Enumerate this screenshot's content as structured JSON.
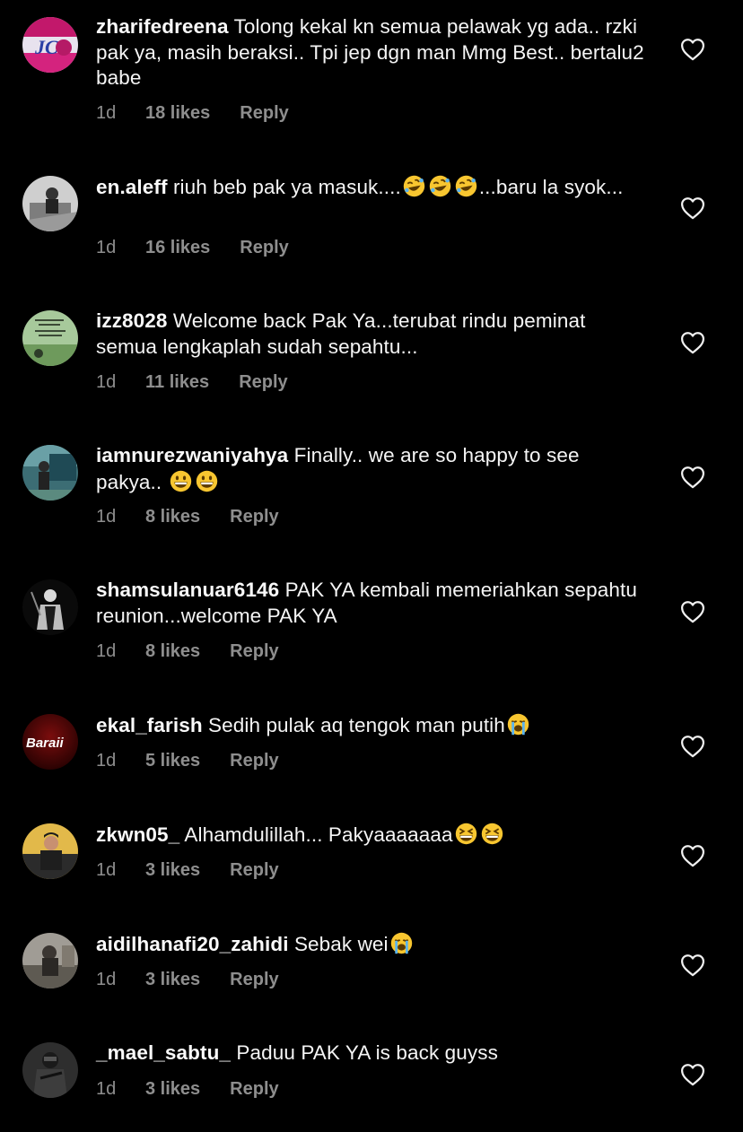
{
  "comments": [
    {
      "username": "zharifedreena",
      "parts": [
        "Tolong kekal kn semua pelawak yg ada.. rzki pak ya, masih beraksi.. Tpi jep dgn man Mmg Best.. bertalu2 babe"
      ],
      "time": "1d",
      "likes": "18 likes",
      "reply": "Reply",
      "avatar": "avatar-pink-logo"
    },
    {
      "username": "en.aleff",
      "parts": [
        "riuh beb pak ya masuk....",
        "rofl-emoji",
        "rofl-emoji",
        "rofl-emoji",
        "...baru la syok..."
      ],
      "time": "1d",
      "likes": "16 likes",
      "reply": "Reply",
      "avatar": "avatar-bw-photo"
    },
    {
      "username": "izz8028",
      "parts": [
        "Welcome back Pak Ya...terubat rindu peminat  semua lengkaplah sudah sepahtu..."
      ],
      "time": "1d",
      "likes": "11 likes",
      "reply": "Reply",
      "avatar": "avatar-green-text"
    },
    {
      "username": "iamnurezwaniyahya",
      "parts": [
        "Finally.. we are so happy to see pakya.. ",
        "grin-emoji",
        "grin-emoji"
      ],
      "time": "1d",
      "likes": "8 likes",
      "reply": "Reply",
      "avatar": "avatar-teal-photo"
    },
    {
      "username": "shamsulanuar6146",
      "parts": [
        "PAK YA kembali memeriahkan sepahtu reunion...welcome PAK YA"
      ],
      "time": "1d",
      "likes": "8 likes",
      "reply": "Reply",
      "avatar": "avatar-dark-figure"
    },
    {
      "username": "ekal_farish",
      "parts": [
        "Sedih pulak aq tengok man putih",
        "sob-emoji"
      ],
      "time": "1d",
      "likes": "5 likes",
      "reply": "Reply",
      "avatar": "avatar-baraii"
    },
    {
      "username": "zkwn05_",
      "parts": [
        "Alhamdulillah... Pakyaaaaaaa",
        "laugh-emoji",
        "laugh-emoji"
      ],
      "time": "1d",
      "likes": "3 likes",
      "reply": "Reply",
      "avatar": "avatar-yellow-photo"
    },
    {
      "username": "aidilhanafi20_zahidi",
      "parts": [
        "Sebak wei",
        "sob-emoji"
      ],
      "time": "1d",
      "likes": "3 likes",
      "reply": "Reply",
      "avatar": "avatar-grey-photo"
    },
    {
      "username": "_mael_sabtu_",
      "parts": [
        "Paduu PAK YA is back guyss"
      ],
      "time": "1d",
      "likes": "3 likes",
      "reply": "Reply",
      "avatar": "avatar-soldier"
    }
  ],
  "avatar_text": {
    "baraii": "Baraii"
  },
  "colors": {
    "background": "#000000",
    "text": "#f5f5f5",
    "meta": "#8e8e8e"
  },
  "icons": {
    "like": "heart-outline-icon"
  }
}
